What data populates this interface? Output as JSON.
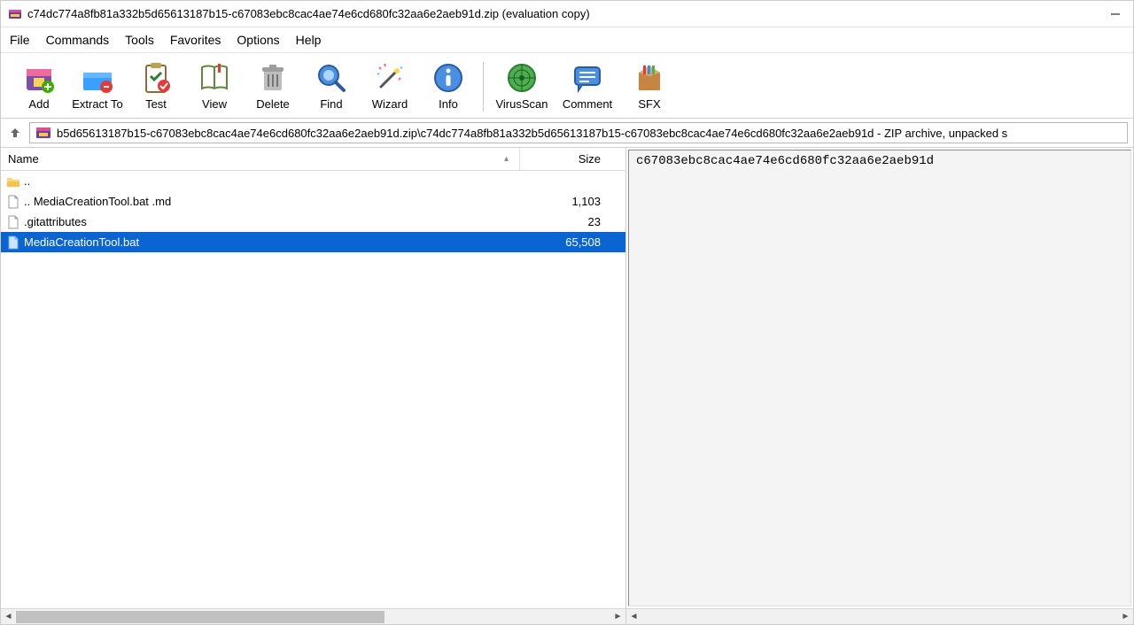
{
  "title": "c74dc774a8fb81a332b5d65613187b15-c67083ebc8cac4ae74e6cd680fc32aa6e2aeb91d.zip (evaluation copy)",
  "menu": [
    "File",
    "Commands",
    "Tools",
    "Favorites",
    "Options",
    "Help"
  ],
  "toolbar": {
    "add": "Add",
    "extract": "Extract To",
    "test": "Test",
    "view": "View",
    "delete": "Delete",
    "find": "Find",
    "wizard": "Wizard",
    "info": "Info",
    "virusscan": "VirusScan",
    "comment": "Comment",
    "sfx": "SFX"
  },
  "address": "b5d65613187b15-c67083ebc8cac4ae74e6cd680fc32aa6e2aeb91d.zip\\c74dc774a8fb81a332b5d65613187b15-c67083ebc8cac4ae74e6cd680fc32aa6e2aeb91d - ZIP archive, unpacked s",
  "columns": {
    "name": "Name",
    "size": "Size"
  },
  "rows": [
    {
      "icon": "folder-up",
      "name": "..",
      "size": ""
    },
    {
      "icon": "file",
      "name": ".. MediaCreationTool.bat .md",
      "size": "1,103"
    },
    {
      "icon": "file",
      "name": ".gitattributes",
      "size": "23"
    },
    {
      "icon": "file-sel",
      "name": "MediaCreationTool.bat",
      "size": "65,508",
      "selected": true
    }
  ],
  "preview_text": "c67083ebc8cac4ae74e6cd680fc32aa6e2aeb91d"
}
